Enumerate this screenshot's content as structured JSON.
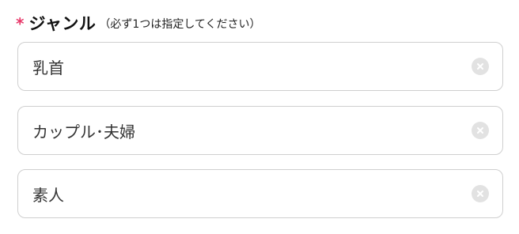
{
  "genre": {
    "required_mark": "*",
    "label": "ジャンル",
    "hint": "（必ず1つは指定してください）",
    "items": [
      {
        "label": "乳首"
      },
      {
        "label": "カップル･夫婦"
      },
      {
        "label": "素人"
      }
    ]
  },
  "colors": {
    "required": "#e8396a",
    "border": "#cfcfcf",
    "clear_button": "#e2e2e2"
  },
  "icons": {
    "clear": "close-circle-icon"
  }
}
